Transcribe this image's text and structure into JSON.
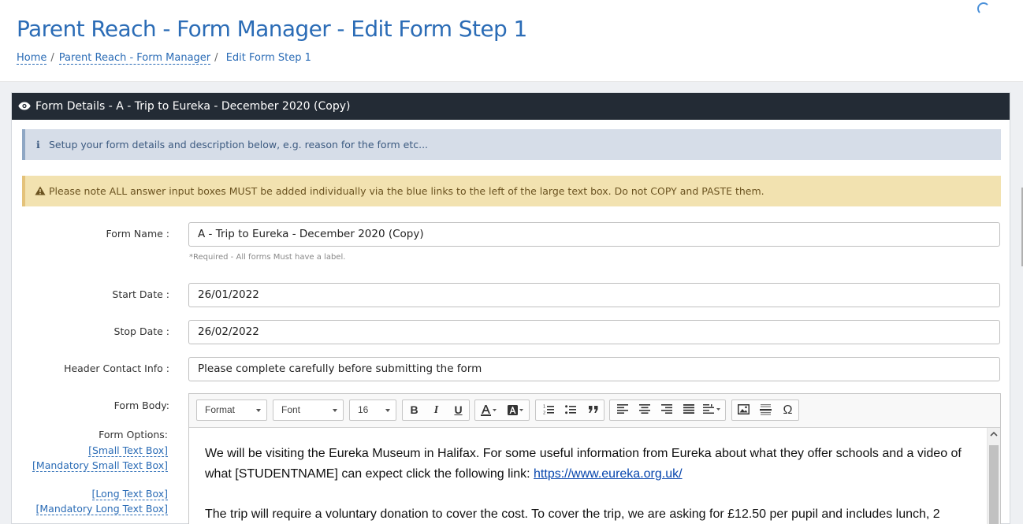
{
  "page": {
    "title": "Parent Reach - Form Manager - Edit Form Step 1",
    "breadcrumb": {
      "home": "Home",
      "parent": "Parent Reach - Form Manager",
      "current": "Edit Form Step 1"
    }
  },
  "panel": {
    "heading": "Form Details - A - Trip to Eureka - December 2020 (Copy)",
    "info_alert": "Setup your form details and description below, e.g. reason for the form etc...",
    "warning_alert": "Please note ALL answer input boxes MUST be added individually via the blue links to the left of the large text box. Do not COPY and PASTE them."
  },
  "form": {
    "form_name_label": "Form Name :",
    "form_name_value": "A - Trip to Eureka - December 2020 (Copy)",
    "form_name_hint": "*Required - All forms Must have a label.",
    "start_date_label": "Start Date :",
    "start_date_value": "26/01/2022",
    "stop_date_label": "Stop Date :",
    "stop_date_value": "26/02/2022",
    "header_contact_label": "Header Contact Info :",
    "header_contact_value": "Please complete carefully before submitting the form",
    "form_body_label": "Form Body:",
    "options_title": "Form Options:",
    "options": {
      "small_text": "[Small Text Box]",
      "mandatory_small_text": "[Mandatory Small Text Box]",
      "long_text": "[Long Text Box]",
      "mandatory_long_text": "[Mandatory Long Text Box]"
    }
  },
  "editor": {
    "format_label": "Format",
    "font_label": "Font",
    "size_label": "16",
    "bold": "B",
    "italic": "I",
    "underline": "U",
    "special_char": "Ω",
    "para1_text": "We will be visiting the Eureka Museum in Halifax. For some useful information from Eureka about what they offer schools and a video of what [STUDENTNAME] can expect click the following link: ",
    "para1_link": "https://www.eureka.org.uk/",
    "para2_text": "The trip will require a voluntary donation to cover the cost. To cover the trip, we are asking for £12.50 per pupil and includes lunch, 2"
  },
  "colors": {
    "accent": "#2b6cb6",
    "panel_header": "#232b35",
    "info_bg": "#d6dde8",
    "warning_bg": "#f2e2b0"
  }
}
